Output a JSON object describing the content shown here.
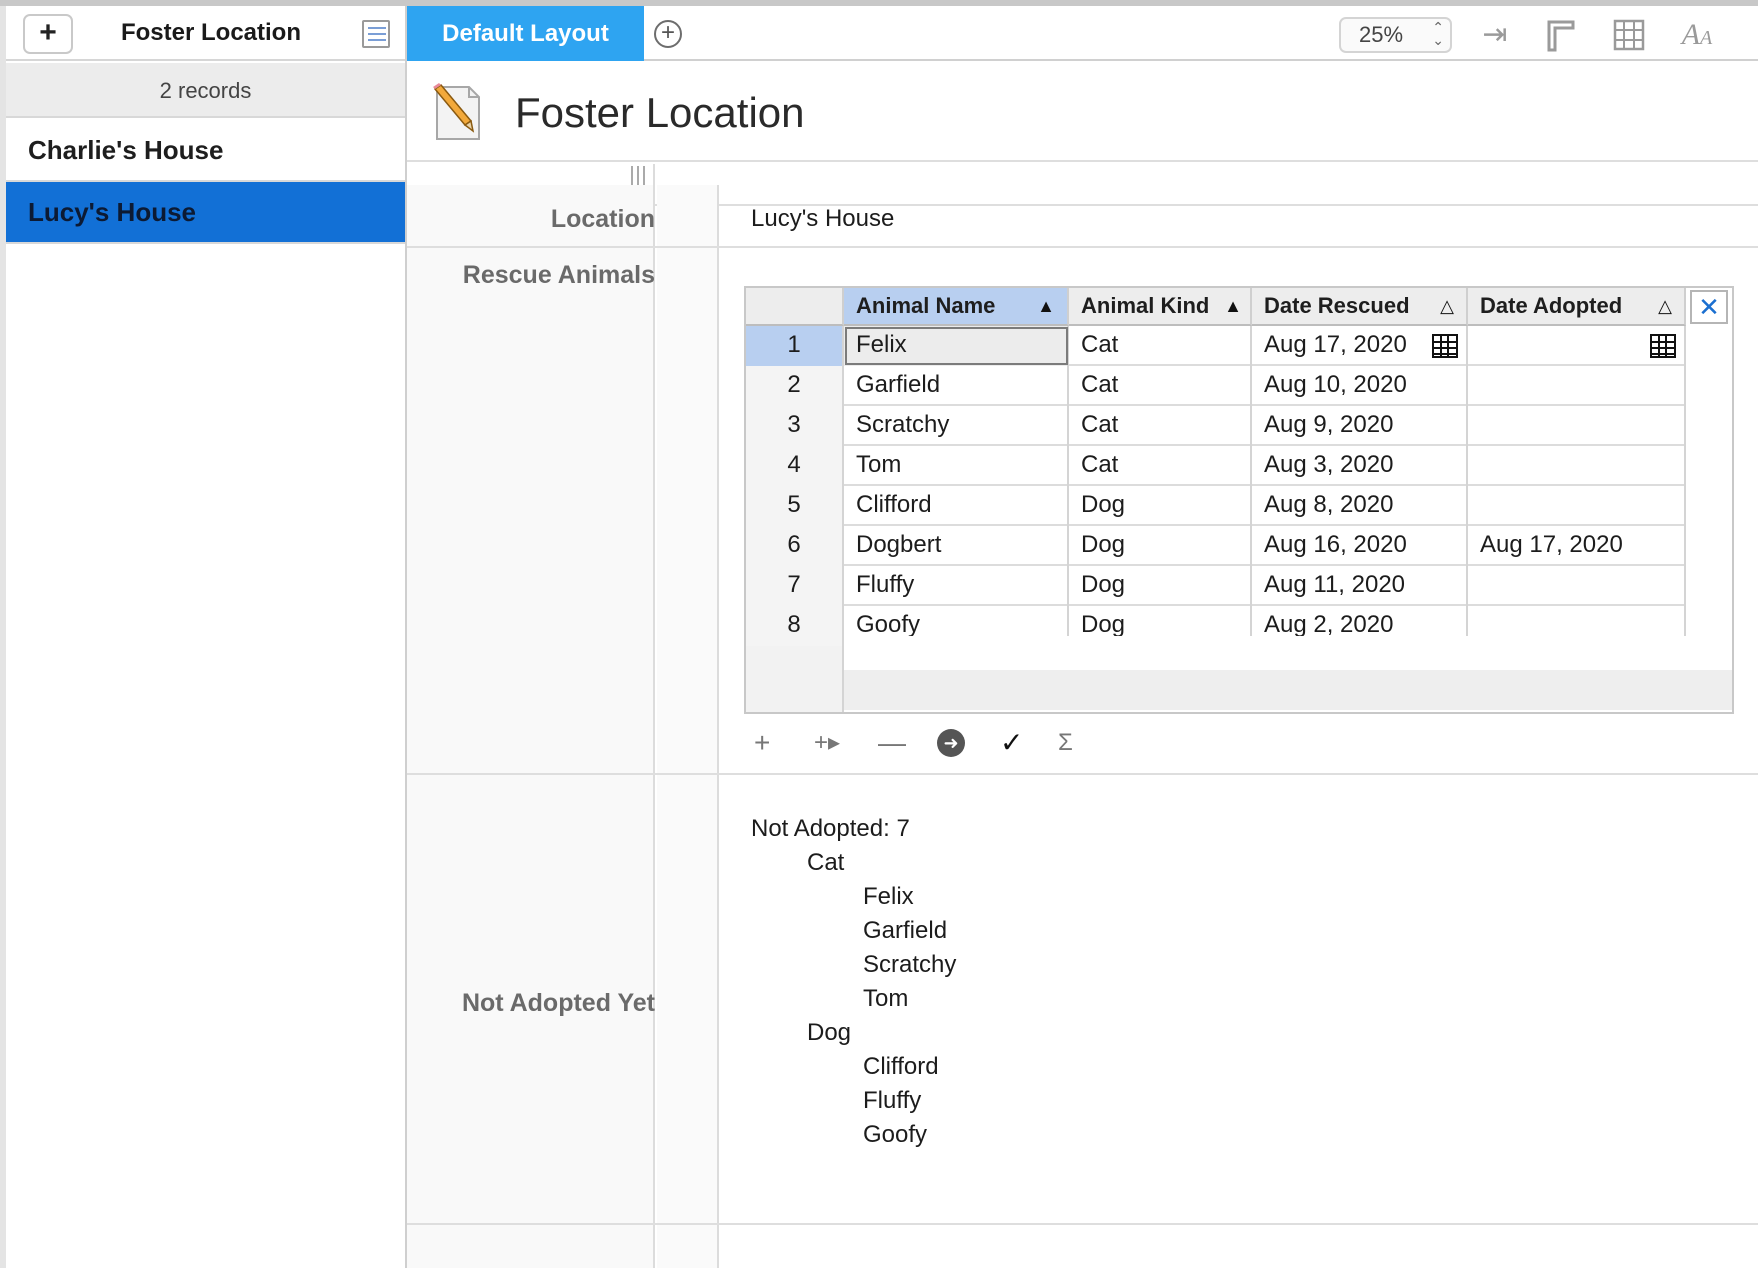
{
  "sidebar": {
    "add_label": "+",
    "title": "Foster Location",
    "records_count": "2 records",
    "records": [
      "Charlie's House",
      "Lucy's House"
    ],
    "selected_index": 1
  },
  "toolbar": {
    "layout_tab": "Default Layout",
    "zoom": "25%",
    "icons": [
      "add-layout-icon",
      "tab-order-icon",
      "ruler-icon",
      "grid-icon",
      "text-style-icon"
    ]
  },
  "form": {
    "title": "Foster Location",
    "fields": {
      "location_label": "Location",
      "location_value": "Lucy's House",
      "rescue_label": "Rescue Animals",
      "not_adopted_label": "Not Adopted Yet"
    },
    "subtable": {
      "columns": [
        "Animal Name",
        "Animal Kind",
        "Date Rescued",
        "Date Adopted"
      ],
      "sort_indicators": [
        "▲",
        "▲",
        "△",
        "△"
      ],
      "rows": [
        {
          "num": "1",
          "name": "Felix",
          "kind": "Cat",
          "rescued": "Aug 17, 2020",
          "adopted": ""
        },
        {
          "num": "2",
          "name": "Garfield",
          "kind": "Cat",
          "rescued": "Aug 10, 2020",
          "adopted": ""
        },
        {
          "num": "3",
          "name": "Scratchy",
          "kind": "Cat",
          "rescued": "Aug 9, 2020",
          "adopted": ""
        },
        {
          "num": "4",
          "name": "Tom",
          "kind": "Cat",
          "rescued": "Aug 3, 2020",
          "adopted": ""
        },
        {
          "num": "5",
          "name": "Clifford",
          "kind": "Dog",
          "rescued": "Aug 8, 2020",
          "adopted": ""
        },
        {
          "num": "6",
          "name": "Dogbert",
          "kind": "Dog",
          "rescued": "Aug 16, 2020",
          "adopted": "Aug 17, 2020"
        },
        {
          "num": "7",
          "name": "Fluffy",
          "kind": "Dog",
          "rescued": "Aug 11, 2020",
          "adopted": ""
        },
        {
          "num": "8",
          "name": "Goofy",
          "kind": "Dog",
          "rescued": "Aug 2, 2020",
          "adopted": ""
        }
      ],
      "tools": [
        "+",
        "+▸",
        "—",
        "➜",
        "✓",
        "Σ"
      ]
    },
    "summary": {
      "heading": "Not Adopted: 7",
      "groups": [
        {
          "kind": "Cat",
          "names": [
            "Felix",
            "Garfield",
            "Scratchy",
            "Tom"
          ]
        },
        {
          "kind": "Dog",
          "names": [
            "Clifford",
            "Fluffy",
            "Goofy"
          ]
        }
      ]
    }
  }
}
